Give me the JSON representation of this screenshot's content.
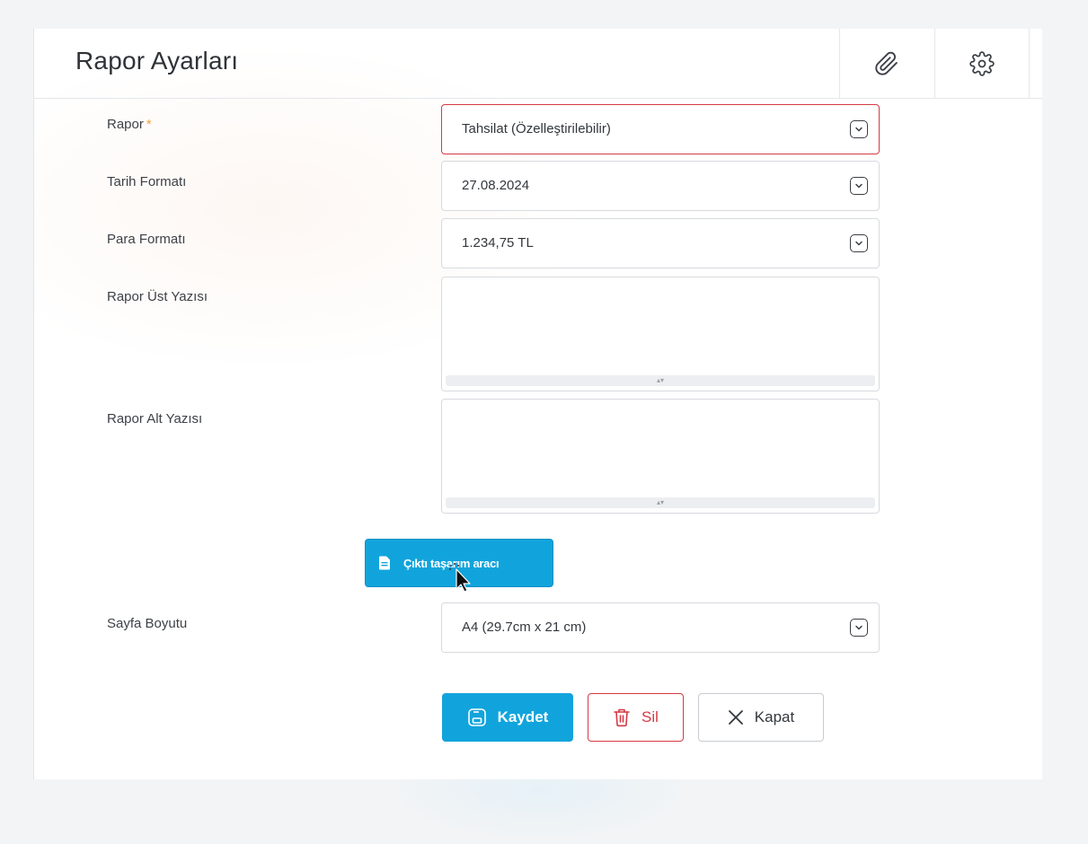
{
  "header": {
    "title": "Rapor Ayarları",
    "attach_icon": "paperclip-icon",
    "settings_icon": "gear-icon"
  },
  "form": {
    "report": {
      "label": "Rapor",
      "required_mark": "*",
      "value": "Tahsilat (Özelleştirilebilir)"
    },
    "date_format": {
      "label": "Tarih Formatı",
      "value": "27.08.2024"
    },
    "money_format": {
      "label": "Para Formatı",
      "value": "1.234,75 TL"
    },
    "header_text": {
      "label": "Rapor Üst Yazısı",
      "value": ""
    },
    "footer_text": {
      "label": "Rapor Alt Yazısı",
      "value": ""
    },
    "design_tool_button": "Çıktı taşarım aracı",
    "page_size": {
      "label": "Sayfa Boyutu",
      "value": "A4 (29.7cm x 21 cm)"
    }
  },
  "actions": {
    "save": "Kaydet",
    "delete": "Sil",
    "close": "Kapat"
  },
  "colors": {
    "primary": "#11a4dc",
    "danger": "#d43a44",
    "required": "#f2a33a"
  }
}
